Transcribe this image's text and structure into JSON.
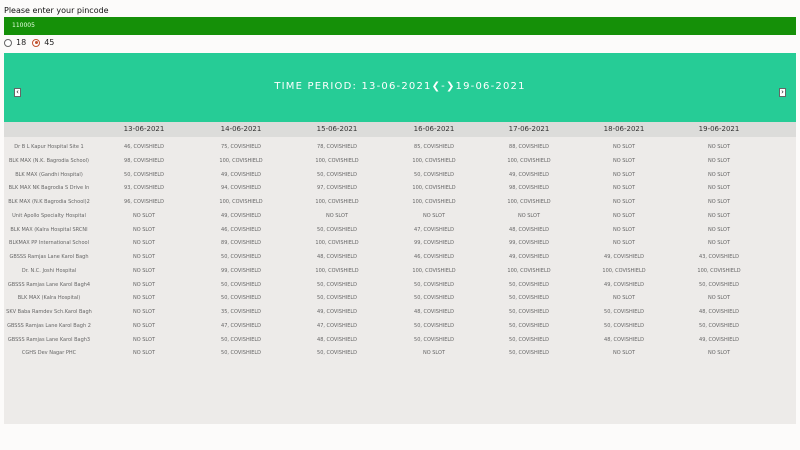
{
  "pincode": {
    "label": "Please enter your pincode",
    "value": "110005"
  },
  "age_filter": {
    "options": [
      "18",
      "45"
    ],
    "selected": "45"
  },
  "banner": {
    "title": "TIME PERIOD: 13-06-2021❮-❯19-06-2021",
    "prev_icon": "left-arrow-icon",
    "next_icon": "right-arrow-icon"
  },
  "colors": {
    "pin_bg": "#159008",
    "banner_bg": "#26cc96",
    "panel_bg": "#edebe9",
    "header_bg": "#dcdcda"
  },
  "table": {
    "dates": [
      "13-06-2021",
      "14-06-2021",
      "15-06-2021",
      "16-06-2021",
      "17-06-2021",
      "18-06-2021",
      "19-06-2021"
    ],
    "rows": [
      {
        "name": "Dr B L Kapur Hospital Site 1",
        "cells": [
          "46, COVISHIELD",
          "75, COVISHIELD",
          "78, COVISHIELD",
          "85, COVISHIELD",
          "88, COVISHIELD",
          "NO SLOT",
          "NO SLOT"
        ]
      },
      {
        "name": "BLK MAX (N.K. Bagrodia School)",
        "cells": [
          "98, COVISHIELD",
          "100, COVISHIELD",
          "100, COVISHIELD",
          "100, COVISHIELD",
          "100, COVISHIELD",
          "NO SLOT",
          "NO SLOT"
        ]
      },
      {
        "name": "BLK MAX (Gandhi Hospital)",
        "cells": [
          "50, COVISHIELD",
          "49, COVISHIELD",
          "50, COVISHIELD",
          "50, COVISHIELD",
          "49, COVISHIELD",
          "NO SLOT",
          "NO SLOT"
        ]
      },
      {
        "name": "BLK MAX NK Bagrodia S Drive In",
        "cells": [
          "93, COVISHIELD",
          "94, COVISHIELD",
          "97, COVISHIELD",
          "100, COVISHIELD",
          "98, COVISHIELD",
          "NO SLOT",
          "NO SLOT"
        ]
      },
      {
        "name": "BLK MAX (N.K Bagrodia School)2",
        "cells": [
          "96, COVISHIELD",
          "100, COVISHIELD",
          "100, COVISHIELD",
          "100, COVISHIELD",
          "100, COVISHIELD",
          "NO SLOT",
          "NO SLOT"
        ]
      },
      {
        "name": "Unit Apollo Specialty Hospital",
        "cells": [
          "NO SLOT",
          "49, COVISHIELD",
          "NO SLOT",
          "NO SLOT",
          "NO SLOT",
          "NO SLOT",
          "NO SLOT"
        ]
      },
      {
        "name": "BLK MAX (Kalra Hospital SRCNI",
        "cells": [
          "NO SLOT",
          "46, COVISHIELD",
          "50, COVISHIELD",
          "47, COVISHIELD",
          "48, COVISHIELD",
          "NO SLOT",
          "NO SLOT"
        ]
      },
      {
        "name": "BLKMAX PP International School",
        "cells": [
          "NO SLOT",
          "89, COVISHIELD",
          "100, COVISHIELD",
          "99, COVISHIELD",
          "99, COVISHIELD",
          "NO SLOT",
          "NO SLOT"
        ]
      },
      {
        "name": "GBSSS Ramjas Lane Karol Bagh",
        "cells": [
          "NO SLOT",
          "50, COVISHIELD",
          "48, COVISHIELD",
          "46, COVISHIELD",
          "49, COVISHIELD",
          "49, COVISHIELD",
          "43, COVISHIELD"
        ]
      },
      {
        "name": "Dr. N.C. Joshi Hospital",
        "cells": [
          "NO SLOT",
          "99, COVISHIELD",
          "100, COVISHIELD",
          "100, COVISHIELD",
          "100, COVISHIELD",
          "100, COVISHIELD",
          "100, COVISHIELD"
        ]
      },
      {
        "name": "GBSSS Ramjas Lane Karol Bagh4",
        "cells": [
          "NO SLOT",
          "50, COVISHIELD",
          "50, COVISHIELD",
          "50, COVISHIELD",
          "50, COVISHIELD",
          "49, COVISHIELD",
          "50, COVISHIELD"
        ]
      },
      {
        "name": "BLK MAX (Kalra Hospital)",
        "cells": [
          "NO SLOT",
          "50, COVISHIELD",
          "50, COVISHIELD",
          "50, COVISHIELD",
          "50, COVISHIELD",
          "NO SLOT",
          "NO SLOT"
        ]
      },
      {
        "name": "SKV Baba Ramdev Sch.Karol Bagh",
        "cells": [
          "NO SLOT",
          "35, COVISHIELD",
          "49, COVISHIELD",
          "48, COVISHIELD",
          "50, COVISHIELD",
          "50, COVISHIELD",
          "48, COVISHIELD"
        ]
      },
      {
        "name": "GBSSS Ramjas Lane Karol Bagh 2",
        "cells": [
          "NO SLOT",
          "47, COVISHIELD",
          "47, COVISHIELD",
          "50, COVISHIELD",
          "50, COVISHIELD",
          "50, COVISHIELD",
          "50, COVISHIELD"
        ]
      },
      {
        "name": "GBSSS Ramjas Lane Karol Bagh3",
        "cells": [
          "NO SLOT",
          "50, COVISHIELD",
          "48, COVISHIELD",
          "50, COVISHIELD",
          "50, COVISHIELD",
          "48, COVISHIELD",
          "49, COVISHIELD"
        ]
      },
      {
        "name": "CGHS Dev Nagar PHC",
        "cells": [
          "NO SLOT",
          "50, COVISHIELD",
          "50, COVISHIELD",
          "NO SLOT",
          "50, COVISHIELD",
          "NO SLOT",
          "NO SLOT"
        ]
      }
    ]
  }
}
